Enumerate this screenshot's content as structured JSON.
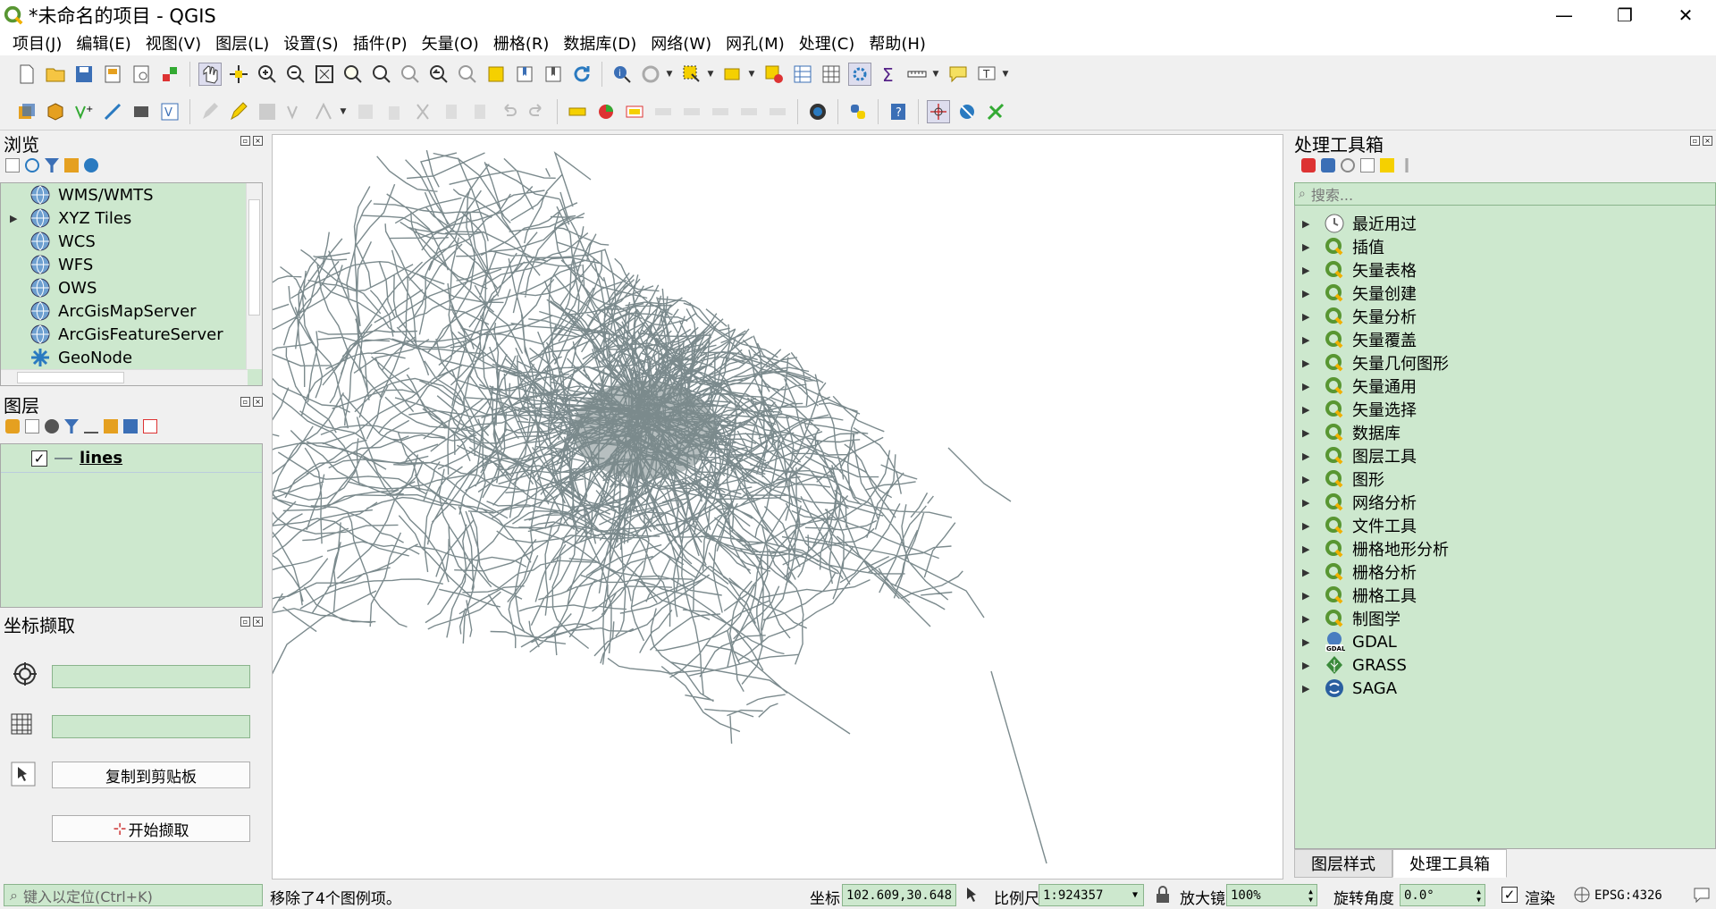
{
  "window": {
    "title": "*未命名的项目 - QGIS",
    "minimize": "—",
    "maximize": "❐",
    "close": "✕"
  },
  "menu": [
    "项目(J)",
    "编辑(E)",
    "视图(V)",
    "图层(L)",
    "设置(S)",
    "插件(P)",
    "矢量(O)",
    "栅格(R)",
    "数据库(D)",
    "网络(W)",
    "网孔(M)",
    "处理(C)",
    "帮助(H)"
  ],
  "browser": {
    "title": "浏览",
    "items": [
      {
        "label": "WMS/WMTS",
        "expandable": false
      },
      {
        "label": "XYZ Tiles",
        "expandable": true
      },
      {
        "label": "WCS",
        "expandable": false
      },
      {
        "label": "WFS",
        "expandable": false
      },
      {
        "label": "OWS",
        "expandable": false
      },
      {
        "label": "ArcGisMapServer",
        "expandable": false
      },
      {
        "label": "ArcGisFeatureServer",
        "expandable": false
      },
      {
        "label": "GeoNode",
        "expandable": false
      }
    ]
  },
  "layers": {
    "title": "图层",
    "items": [
      {
        "name": "lines",
        "checked": true,
        "check_mark": "✓"
      }
    ]
  },
  "coord_capture": {
    "title": "坐标撷取",
    "copy_button": "复制到剪贴板",
    "start_button": "开始撷取"
  },
  "toolbox": {
    "title": "处理工具箱",
    "search_placeholder": "搜索...",
    "items": [
      "最近用过",
      "插值",
      "矢量表格",
      "矢量创建",
      "矢量分析",
      "矢量覆盖",
      "矢量几何图形",
      "矢量通用",
      "矢量选择",
      "数据库",
      "图层工具",
      "图形",
      "网络分析",
      "文件工具",
      "栅格地形分析",
      "栅格分析",
      "栅格工具",
      "制图学",
      "GDAL",
      "GRASS",
      "SAGA"
    ],
    "tabs": [
      "图层样式",
      "处理工具箱"
    ],
    "active_tab": 1
  },
  "status": {
    "locator_placeholder": "键入以定位(Ctrl+K)",
    "message": "移除了4个图例项。",
    "coord_label": "坐标",
    "coord_value": "102.609,30.648",
    "scale_label": "比例尺",
    "scale_value": "1:924357",
    "magnifier_label": "放大镜",
    "magnifier_value": "100%",
    "rotation_label": "旋转角度",
    "rotation_value": "0.0°",
    "render_label": "渲染",
    "crs": "EPSG:4326"
  },
  "colors": {
    "accent_green": "#cde8ce",
    "map_lines": "#7b8a8d",
    "qgis_green": "#589632"
  }
}
